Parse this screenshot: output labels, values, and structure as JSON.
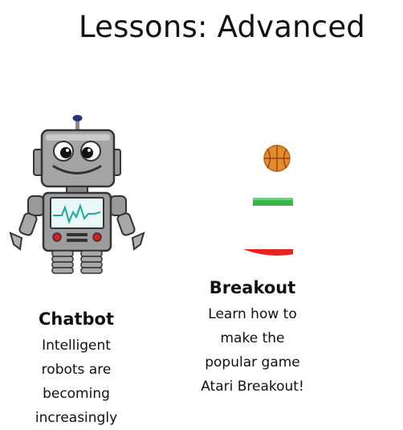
{
  "page": {
    "title": "Lessons: Advanced"
  },
  "lessons": [
    {
      "name": "Chatbot",
      "description": "Intelligent robots are becoming increasingly",
      "image_icon": "robot-icon"
    },
    {
      "name": "Breakout",
      "description": "Learn how to make the popular game Atari Breakout!",
      "image_icon": "breakout-game-icon"
    }
  ],
  "colors": {
    "ball": "#e8892a",
    "paddle": "#3bb54a",
    "floor": "#e8241f",
    "screen_wave": "#1fa79a"
  }
}
